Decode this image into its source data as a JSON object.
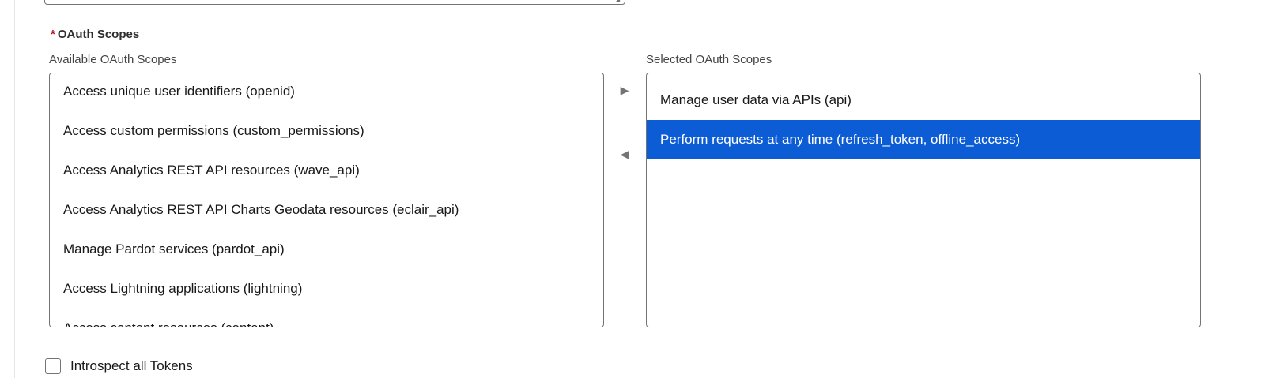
{
  "oauth_scopes": {
    "field_label": "OAuth Scopes",
    "required_mark": "*",
    "available": {
      "label": "Available OAuth Scopes",
      "items": [
        "Access unique user identifiers (openid)",
        "Access custom permissions (custom_permissions)",
        "Access Analytics REST API resources (wave_api)",
        "Access Analytics REST API Charts Geodata resources (eclair_api)",
        "Manage Pardot services (pardot_api)",
        "Access Lightning applications (lightning)",
        "Access content resources (content)"
      ]
    },
    "move_right_icon": "triangle-right-icon",
    "move_left_icon": "triangle-left-icon",
    "selected": {
      "label": "Selected OAuth Scopes",
      "items": [
        "Manage user data via APIs (api)",
        "Perform requests at any time (refresh_token, offline_access)"
      ],
      "highlighted_item": "Perform requests at any time (refresh_token, offline_access)"
    }
  },
  "introspect_tokens": {
    "label": "Introspect all Tokens",
    "checked": false
  },
  "colors": {
    "selection": "#0b5cd5",
    "required": "#ba0517",
    "border": "#747474"
  }
}
